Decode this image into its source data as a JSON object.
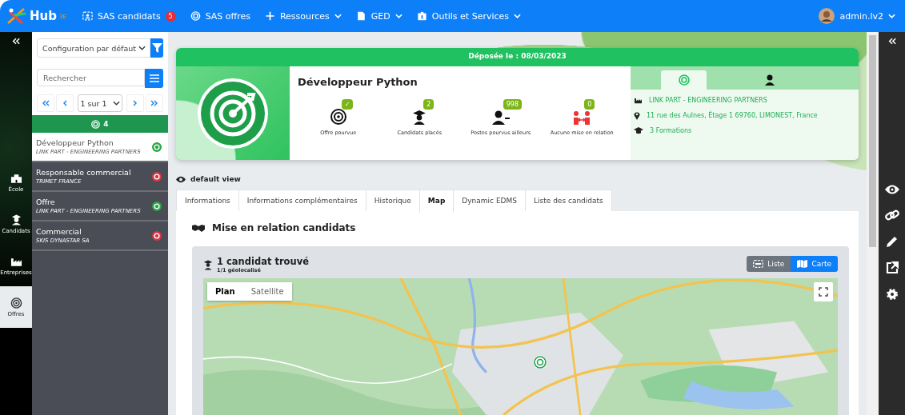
{
  "topbar": {
    "logo": "Hub",
    "logo_sup": "3E",
    "nav": [
      {
        "kind": "candidates",
        "label": "SAS candidats",
        "badge": "5",
        "dropdown": false
      },
      {
        "kind": "offers",
        "label": "SAS offres",
        "dropdown": false
      },
      {
        "kind": "plus",
        "label": "Ressources",
        "dropdown": true
      },
      {
        "kind": "file",
        "label": "GED",
        "dropdown": true
      },
      {
        "kind": "tools",
        "label": "Outils et Services",
        "dropdown": true
      }
    ],
    "user": "admin.lv2"
  },
  "left_rail": {
    "items": [
      {
        "kind": "school",
        "label": "École",
        "selected": false
      },
      {
        "kind": "candidates",
        "label": "Candidats",
        "selected": false
      },
      {
        "kind": "companies",
        "label": "Entreprises",
        "selected": false
      },
      {
        "kind": "offers",
        "label": "Offres",
        "selected": true
      }
    ]
  },
  "sidebar": {
    "config": "Configuration par défaut",
    "search_placeholder": "Rechercher",
    "pager": "1 sur 1",
    "group_count": "4",
    "items": [
      {
        "title": "Développeur Python",
        "company": "LINK PART - ENGINEERING PARTNERS",
        "color": "#28a745",
        "selected": true
      },
      {
        "title": "Responsable commercial",
        "company": "TRIMET FRANCE",
        "color": "#dc3545",
        "selected": false
      },
      {
        "title": "Offre",
        "company": "LINK PART - ENGINEERING PARTNERS",
        "color": "#28a745",
        "selected": false
      },
      {
        "title": "Commercial",
        "company": "SKIS DYNASTAR SA",
        "color": "#dc3545",
        "selected": false
      }
    ]
  },
  "offer": {
    "posted": "Déposée le : 08/03/2023",
    "title": "Développeur Python",
    "stats": [
      {
        "kind": "target",
        "label": "Offre pourvue",
        "badge": "✓"
      },
      {
        "kind": "graduate",
        "label": "Candidats placés",
        "badge": "2"
      },
      {
        "kind": "person",
        "label": "Postes pourvus ailleurs",
        "badge": "998"
      },
      {
        "kind": "relation",
        "label": "Aucune mise en relation",
        "badge": "0"
      }
    ],
    "tabs": [
      {
        "kind": "target",
        "selected": true
      },
      {
        "kind": "person",
        "selected": false
      }
    ],
    "info": [
      {
        "kind": "company",
        "text": "LINK PART - ENGINEERING PARTNERS"
      },
      {
        "kind": "location",
        "text": "11 rue des Aulnes, Étage 1 69760, LIMONEST, France"
      },
      {
        "kind": "education",
        "text": "3 Formations"
      }
    ]
  },
  "view": "default view",
  "tabs": [
    {
      "label": "Informations",
      "selected": false
    },
    {
      "label": "Informations complémentaires",
      "selected": false
    },
    {
      "label": "Historique",
      "selected": false
    },
    {
      "label": "Map",
      "selected": true
    },
    {
      "label": "Dynamic EDMS",
      "selected": false
    },
    {
      "label": "Liste des candidats",
      "selected": false
    }
  ],
  "section_title": "Mise en relation candidats",
  "results": {
    "title": "1 candidat trouvé",
    "subtitle": "1/1 géolocalisé",
    "views": [
      {
        "kind": "list",
        "label": "Liste",
        "selected": false
      },
      {
        "kind": "map",
        "label": "Carte",
        "selected": true
      }
    ]
  },
  "map": {
    "kind": "picture",
    "types": [
      {
        "label": "Plan",
        "selected": true
      },
      {
        "label": "Satellite",
        "selected": false
      }
    ]
  }
}
